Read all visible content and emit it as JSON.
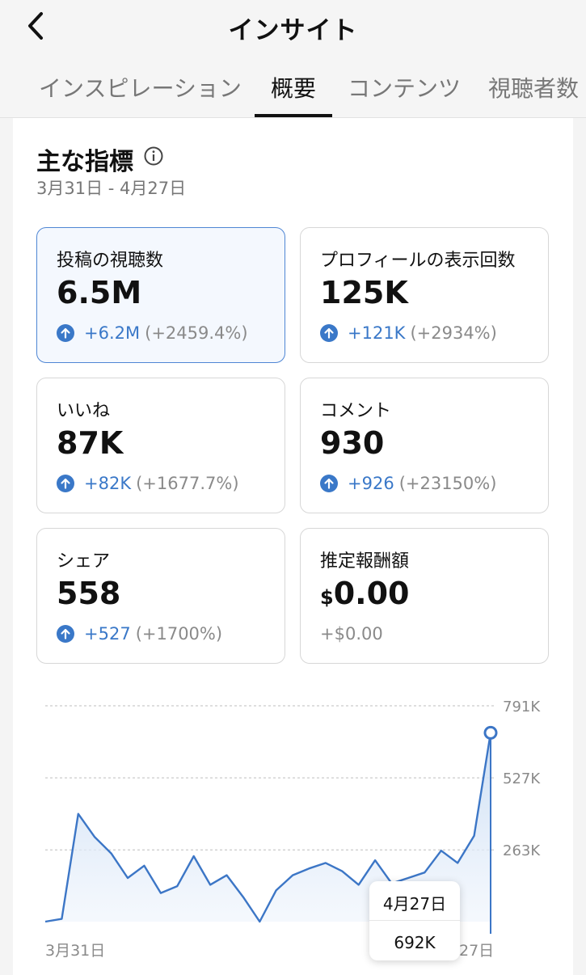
{
  "header": {
    "title": "インサイト",
    "back_icon": "chevron-left-icon"
  },
  "tabs": [
    {
      "label": "インスピレーション",
      "active": false
    },
    {
      "label": "概要",
      "active": true
    },
    {
      "label": "コンテンツ",
      "active": false
    },
    {
      "label": "視聴者数",
      "active": false
    }
  ],
  "overview": {
    "title": "主な指標",
    "info_icon": "info-icon",
    "date_range": "3月31日 - 4月27日"
  },
  "metrics": [
    {
      "label": "投稿の視聴数",
      "value": "6.5M",
      "delta_abs": "+6.2M",
      "delta_pct": "(+2459.4%)",
      "selected": true
    },
    {
      "label": "プロフィールの表示回数",
      "value": "125K",
      "delta_abs": "+121K",
      "delta_pct": "(+2934%)"
    },
    {
      "label": "いいね",
      "value": "87K",
      "delta_abs": "+82K",
      "delta_pct": "(+1677.7%)"
    },
    {
      "label": "コメント",
      "value": "930",
      "delta_abs": "+926",
      "delta_pct": "(+23150%)"
    },
    {
      "label": "シェア",
      "value": "558",
      "delta_abs": "+527",
      "delta_pct": "(+1700%)"
    },
    {
      "label": "推定報酬額",
      "currency": "$",
      "value": "0.00",
      "delta_plain": "+$0.00"
    }
  ],
  "colors": {
    "accent": "#3a78c8",
    "selected_border": "#4f86d4",
    "muted": "#8a8a8a"
  },
  "chart_data": {
    "type": "area",
    "ylim": [
      0,
      791000
    ],
    "y_ticks": [
      263000,
      527000,
      791000
    ],
    "y_tick_labels": [
      "263K",
      "527K",
      "791K"
    ],
    "x_start_label": "3月31日",
    "x_end_label": "27日",
    "grid": true,
    "series": [
      {
        "values": [
          0,
          10000,
          395000,
          310000,
          250000,
          160000,
          205000,
          105000,
          130000,
          240000,
          135000,
          170000,
          90000,
          0,
          115000,
          170000,
          195000,
          215000,
          185000,
          135000,
          225000,
          140000,
          160000,
          180000,
          260000,
          215000,
          315000,
          692000
        ]
      }
    ],
    "selected_point": {
      "date": "4月27日",
      "value": "692K"
    }
  }
}
